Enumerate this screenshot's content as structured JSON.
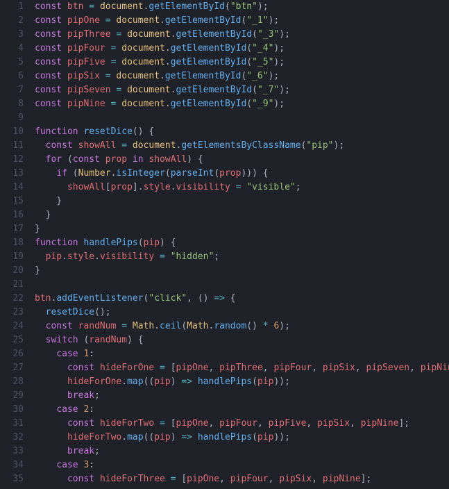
{
  "line_count": 35,
  "lines": [
    [
      [
        "kw",
        "const"
      ],
      [
        "pun",
        " "
      ],
      [
        "var",
        "btn"
      ],
      [
        "pun",
        " "
      ],
      [
        "op",
        "="
      ],
      [
        "pun",
        " "
      ],
      [
        "obj",
        "document"
      ],
      [
        "pun",
        "."
      ],
      [
        "fn",
        "getElementById"
      ],
      [
        "pun",
        "("
      ],
      [
        "str",
        "\"btn\""
      ],
      [
        "pun",
        ");"
      ]
    ],
    [
      [
        "kw",
        "const"
      ],
      [
        "pun",
        " "
      ],
      [
        "var",
        "pipOne"
      ],
      [
        "pun",
        " "
      ],
      [
        "op",
        "="
      ],
      [
        "pun",
        " "
      ],
      [
        "obj",
        "document"
      ],
      [
        "pun",
        "."
      ],
      [
        "fn",
        "getElementById"
      ],
      [
        "pun",
        "("
      ],
      [
        "str",
        "\"_1\""
      ],
      [
        "pun",
        ");"
      ]
    ],
    [
      [
        "kw",
        "const"
      ],
      [
        "pun",
        " "
      ],
      [
        "var",
        "pipThree"
      ],
      [
        "pun",
        " "
      ],
      [
        "op",
        "="
      ],
      [
        "pun",
        " "
      ],
      [
        "obj",
        "document"
      ],
      [
        "pun",
        "."
      ],
      [
        "fn",
        "getElementById"
      ],
      [
        "pun",
        "("
      ],
      [
        "str",
        "\"_3\""
      ],
      [
        "pun",
        ");"
      ]
    ],
    [
      [
        "kw",
        "const"
      ],
      [
        "pun",
        " "
      ],
      [
        "var",
        "pipFour"
      ],
      [
        "pun",
        " "
      ],
      [
        "op",
        "="
      ],
      [
        "pun",
        " "
      ],
      [
        "obj",
        "document"
      ],
      [
        "pun",
        "."
      ],
      [
        "fn",
        "getElementById"
      ],
      [
        "pun",
        "("
      ],
      [
        "str",
        "\"_4\""
      ],
      [
        "pun",
        ");"
      ]
    ],
    [
      [
        "kw",
        "const"
      ],
      [
        "pun",
        " "
      ],
      [
        "var",
        "pipFive"
      ],
      [
        "pun",
        " "
      ],
      [
        "op",
        "="
      ],
      [
        "pun",
        " "
      ],
      [
        "obj",
        "document"
      ],
      [
        "pun",
        "."
      ],
      [
        "fn",
        "getElementById"
      ],
      [
        "pun",
        "("
      ],
      [
        "str",
        "\"_5\""
      ],
      [
        "pun",
        ");"
      ]
    ],
    [
      [
        "kw",
        "const"
      ],
      [
        "pun",
        " "
      ],
      [
        "var",
        "pipSix"
      ],
      [
        "pun",
        " "
      ],
      [
        "op",
        "="
      ],
      [
        "pun",
        " "
      ],
      [
        "obj",
        "document"
      ],
      [
        "pun",
        "."
      ],
      [
        "fn",
        "getElementById"
      ],
      [
        "pun",
        "("
      ],
      [
        "str",
        "\"_6\""
      ],
      [
        "pun",
        ");"
      ]
    ],
    [
      [
        "kw",
        "const"
      ],
      [
        "pun",
        " "
      ],
      [
        "var",
        "pipSeven"
      ],
      [
        "pun",
        " "
      ],
      [
        "op",
        "="
      ],
      [
        "pun",
        " "
      ],
      [
        "obj",
        "document"
      ],
      [
        "pun",
        "."
      ],
      [
        "fn",
        "getElementById"
      ],
      [
        "pun",
        "("
      ],
      [
        "str",
        "\"_7\""
      ],
      [
        "pun",
        ");"
      ]
    ],
    [
      [
        "kw",
        "const"
      ],
      [
        "pun",
        " "
      ],
      [
        "var",
        "pipNine"
      ],
      [
        "pun",
        " "
      ],
      [
        "op",
        "="
      ],
      [
        "pun",
        " "
      ],
      [
        "obj",
        "document"
      ],
      [
        "pun",
        "."
      ],
      [
        "fn",
        "getElementById"
      ],
      [
        "pun",
        "("
      ],
      [
        "str",
        "\"_9\""
      ],
      [
        "pun",
        ");"
      ]
    ],
    [],
    [
      [
        "kw",
        "function"
      ],
      [
        "pun",
        " "
      ],
      [
        "def",
        "resetDice"
      ],
      [
        "pun",
        "() {"
      ]
    ],
    [
      [
        "pun",
        "  "
      ],
      [
        "kw",
        "const"
      ],
      [
        "pun",
        " "
      ],
      [
        "var",
        "showAll"
      ],
      [
        "pun",
        " "
      ],
      [
        "op",
        "="
      ],
      [
        "pun",
        " "
      ],
      [
        "obj",
        "document"
      ],
      [
        "pun",
        "."
      ],
      [
        "fn",
        "getElementsByClassName"
      ],
      [
        "pun",
        "("
      ],
      [
        "str",
        "\"pip\""
      ],
      [
        "pun",
        ");"
      ]
    ],
    [
      [
        "pun",
        "  "
      ],
      [
        "kw",
        "for"
      ],
      [
        "pun",
        " ("
      ],
      [
        "kw",
        "const"
      ],
      [
        "pun",
        " "
      ],
      [
        "var",
        "prop"
      ],
      [
        "pun",
        " "
      ],
      [
        "kw",
        "in"
      ],
      [
        "pun",
        " "
      ],
      [
        "var",
        "showAll"
      ],
      [
        "pun",
        ") {"
      ]
    ],
    [
      [
        "pun",
        "    "
      ],
      [
        "kw",
        "if"
      ],
      [
        "pun",
        " ("
      ],
      [
        "obj",
        "Number"
      ],
      [
        "pun",
        "."
      ],
      [
        "fn",
        "isInteger"
      ],
      [
        "pun",
        "("
      ],
      [
        "fn",
        "parseInt"
      ],
      [
        "pun",
        "("
      ],
      [
        "var",
        "prop"
      ],
      [
        "pun",
        "))) {"
      ]
    ],
    [
      [
        "pun",
        "      "
      ],
      [
        "var",
        "showAll"
      ],
      [
        "pun",
        "["
      ],
      [
        "var",
        "prop"
      ],
      [
        "pun",
        "]."
      ],
      [
        "prop",
        "style"
      ],
      [
        "pun",
        "."
      ],
      [
        "prop",
        "visibility"
      ],
      [
        "pun",
        " "
      ],
      [
        "op",
        "="
      ],
      [
        "pun",
        " "
      ],
      [
        "str",
        "\"visible\""
      ],
      [
        "pun",
        ";"
      ]
    ],
    [
      [
        "pun",
        "    }"
      ]
    ],
    [
      [
        "pun",
        "  }"
      ]
    ],
    [
      [
        "pun",
        "}"
      ]
    ],
    [
      [
        "kw",
        "function"
      ],
      [
        "pun",
        " "
      ],
      [
        "def",
        "handlePips"
      ],
      [
        "pun",
        "("
      ],
      [
        "var",
        "pip"
      ],
      [
        "pun",
        ") {"
      ]
    ],
    [
      [
        "pun",
        "  "
      ],
      [
        "var",
        "pip"
      ],
      [
        "pun",
        "."
      ],
      [
        "prop",
        "style"
      ],
      [
        "pun",
        "."
      ],
      [
        "prop",
        "visibility"
      ],
      [
        "pun",
        " "
      ],
      [
        "op",
        "="
      ],
      [
        "pun",
        " "
      ],
      [
        "str",
        "\"hidden\""
      ],
      [
        "pun",
        ";"
      ]
    ],
    [
      [
        "pun",
        "}"
      ]
    ],
    [],
    [
      [
        "var",
        "btn"
      ],
      [
        "pun",
        "."
      ],
      [
        "fn",
        "addEventListener"
      ],
      [
        "pun",
        "("
      ],
      [
        "str",
        "\"click\""
      ],
      [
        "pun",
        ", () "
      ],
      [
        "op",
        "=>"
      ],
      [
        "pun",
        " {"
      ]
    ],
    [
      [
        "pun",
        "  "
      ],
      [
        "fn",
        "resetDice"
      ],
      [
        "pun",
        "();"
      ]
    ],
    [
      [
        "pun",
        "  "
      ],
      [
        "kw",
        "const"
      ],
      [
        "pun",
        " "
      ],
      [
        "var",
        "randNum"
      ],
      [
        "pun",
        " "
      ],
      [
        "op",
        "="
      ],
      [
        "pun",
        " "
      ],
      [
        "obj",
        "Math"
      ],
      [
        "pun",
        "."
      ],
      [
        "fn",
        "ceil"
      ],
      [
        "pun",
        "("
      ],
      [
        "obj",
        "Math"
      ],
      [
        "pun",
        "."
      ],
      [
        "fn",
        "random"
      ],
      [
        "pun",
        "() "
      ],
      [
        "op",
        "*"
      ],
      [
        "pun",
        " "
      ],
      [
        "num",
        "6"
      ],
      [
        "pun",
        ");"
      ]
    ],
    [
      [
        "pun",
        "  "
      ],
      [
        "kw",
        "switch"
      ],
      [
        "pun",
        " ("
      ],
      [
        "var",
        "randNum"
      ],
      [
        "pun",
        ") {"
      ]
    ],
    [
      [
        "pun",
        "    "
      ],
      [
        "kw",
        "case"
      ],
      [
        "pun",
        " "
      ],
      [
        "num",
        "1"
      ],
      [
        "pun",
        ":"
      ]
    ],
    [
      [
        "pun",
        "      "
      ],
      [
        "kw",
        "const"
      ],
      [
        "pun",
        " "
      ],
      [
        "var",
        "hideForOne"
      ],
      [
        "pun",
        " "
      ],
      [
        "op",
        "="
      ],
      [
        "pun",
        " ["
      ],
      [
        "var",
        "pipOne"
      ],
      [
        "pun",
        ", "
      ],
      [
        "var",
        "pipThree"
      ],
      [
        "pun",
        ", "
      ],
      [
        "var",
        "pipFour"
      ],
      [
        "pun",
        ", "
      ],
      [
        "var",
        "pipSix"
      ],
      [
        "pun",
        ", "
      ],
      [
        "var",
        "pipSeven"
      ],
      [
        "pun",
        ", "
      ],
      [
        "var",
        "pipNine"
      ],
      [
        "pun",
        "];"
      ]
    ],
    [
      [
        "pun",
        "      "
      ],
      [
        "var",
        "hideForOne"
      ],
      [
        "pun",
        "."
      ],
      [
        "fn",
        "map"
      ],
      [
        "pun",
        "(("
      ],
      [
        "var",
        "pip"
      ],
      [
        "pun",
        ") "
      ],
      [
        "op",
        "=>"
      ],
      [
        "pun",
        " "
      ],
      [
        "fn",
        "handlePips"
      ],
      [
        "pun",
        "("
      ],
      [
        "var",
        "pip"
      ],
      [
        "pun",
        "));"
      ]
    ],
    [
      [
        "pun",
        "      "
      ],
      [
        "kw",
        "break"
      ],
      [
        "pun",
        ";"
      ]
    ],
    [
      [
        "pun",
        "    "
      ],
      [
        "kw",
        "case"
      ],
      [
        "pun",
        " "
      ],
      [
        "num",
        "2"
      ],
      [
        "pun",
        ":"
      ]
    ],
    [
      [
        "pun",
        "      "
      ],
      [
        "kw",
        "const"
      ],
      [
        "pun",
        " "
      ],
      [
        "var",
        "hideForTwo"
      ],
      [
        "pun",
        " "
      ],
      [
        "op",
        "="
      ],
      [
        "pun",
        " ["
      ],
      [
        "var",
        "pipOne"
      ],
      [
        "pun",
        ", "
      ],
      [
        "var",
        "pipFour"
      ],
      [
        "pun",
        ", "
      ],
      [
        "var",
        "pipFive"
      ],
      [
        "pun",
        ", "
      ],
      [
        "var",
        "pipSix"
      ],
      [
        "pun",
        ", "
      ],
      [
        "var",
        "pipNine"
      ],
      [
        "pun",
        "];"
      ]
    ],
    [
      [
        "pun",
        "      "
      ],
      [
        "var",
        "hideForTwo"
      ],
      [
        "pun",
        "."
      ],
      [
        "fn",
        "map"
      ],
      [
        "pun",
        "(("
      ],
      [
        "var",
        "pip"
      ],
      [
        "pun",
        ") "
      ],
      [
        "op",
        "=>"
      ],
      [
        "pun",
        " "
      ],
      [
        "fn",
        "handlePips"
      ],
      [
        "pun",
        "("
      ],
      [
        "var",
        "pip"
      ],
      [
        "pun",
        "));"
      ]
    ],
    [
      [
        "pun",
        "      "
      ],
      [
        "kw",
        "break"
      ],
      [
        "pun",
        ";"
      ]
    ],
    [
      [
        "pun",
        "    "
      ],
      [
        "kw",
        "case"
      ],
      [
        "pun",
        " "
      ],
      [
        "num",
        "3"
      ],
      [
        "pun",
        ":"
      ]
    ],
    [
      [
        "pun",
        "      "
      ],
      [
        "kw",
        "const"
      ],
      [
        "pun",
        " "
      ],
      [
        "var",
        "hideForThree"
      ],
      [
        "pun",
        " "
      ],
      [
        "op",
        "="
      ],
      [
        "pun",
        " ["
      ],
      [
        "var",
        "pipOne"
      ],
      [
        "pun",
        ", "
      ],
      [
        "var",
        "pipFour"
      ],
      [
        "pun",
        ", "
      ],
      [
        "var",
        "pipSix"
      ],
      [
        "pun",
        ", "
      ],
      [
        "var",
        "pipNine"
      ],
      [
        "pun",
        "];"
      ]
    ]
  ]
}
